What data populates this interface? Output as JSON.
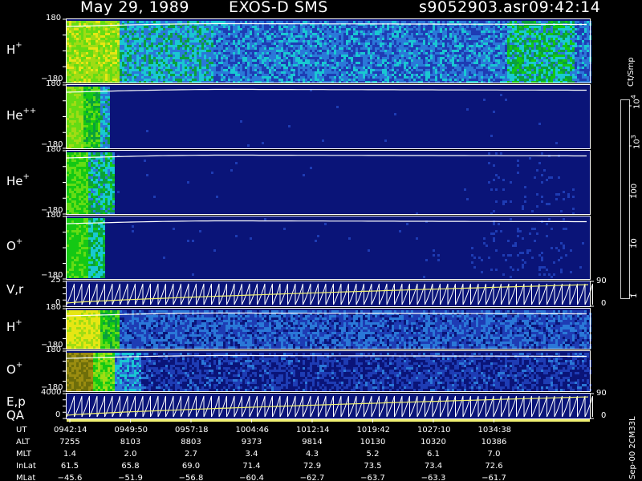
{
  "header": {
    "date": "May 29, 1989",
    "instrument": "EXOS-D SMS",
    "file": "s9052903.asr",
    "time": "09:42:14"
  },
  "colors": {
    "background": "#000000",
    "panel_fill": "#0a1478",
    "trace": "#ffffff",
    "position_line": "#f0f070"
  },
  "panels": [
    {
      "id": "h-plus-1",
      "species": "H",
      "charge": "+",
      "ymax": "180",
      "ymin": "−180"
    },
    {
      "id": "he-plus-plus",
      "species": "He",
      "charge": "++",
      "ymax": "180",
      "ymin": "−180"
    },
    {
      "id": "he-plus",
      "species": "He",
      "charge": "+",
      "ymax": "180",
      "ymin": "−180"
    },
    {
      "id": "o-plus-1",
      "species": "O",
      "charge": "+",
      "ymax": "180",
      "ymin": "−180"
    },
    {
      "id": "vr",
      "label": "V,r",
      "ymax": "25",
      "ymin": "0",
      "right_top": "90",
      "right_bottom": "0"
    },
    {
      "id": "h-plus-2",
      "species": "H",
      "charge": "+",
      "ymax": "180",
      "ymin": "−180"
    },
    {
      "id": "o-plus-2",
      "species": "O",
      "charge": "+",
      "ymax": "180",
      "ymin": "−180"
    },
    {
      "id": "ep",
      "label": "E,p",
      "label2": "QA",
      "ymax": "4000",
      "ymin": "0",
      "right_top": "90",
      "right_bottom": "0"
    }
  ],
  "colorbar": {
    "unit": "Ct/Smp",
    "ticks": [
      "1",
      "10",
      "100",
      "10",
      "10"
    ],
    "tick_exponents": [
      "",
      "",
      "",
      "3",
      "4"
    ],
    "colors": [
      "#0a1478",
      "#1e3cb4",
      "#2a78d8",
      "#19c8d2",
      "#0aa03c",
      "#14c814",
      "#64dc14",
      "#a0dc14",
      "#e6e614",
      "#9a8c10",
      "#6e6e0a",
      "#d21e0a",
      "#8c0a0a",
      "#ffffff"
    ]
  },
  "footer": {
    "rows": [
      {
        "name": "UT",
        "values": [
          "0942:14",
          "0949:50",
          "0957:18",
          "1004:46",
          "1012:14",
          "1019:42",
          "1027:10",
          "1034:38"
        ]
      },
      {
        "name": "ALT",
        "values": [
          "7255",
          "8103",
          "8803",
          "9373",
          "9814",
          "10130",
          "10320",
          "10386"
        ]
      },
      {
        "name": "MLT",
        "values": [
          "1.4",
          "2.0",
          "2.7",
          "3.4",
          "4.3",
          "5.2",
          "6.1",
          "7.0"
        ]
      },
      {
        "name": "InLat",
        "values": [
          "61.5",
          "65.8",
          "69.0",
          "71.4",
          "72.9",
          "73.5",
          "73.4",
          "72.6"
        ]
      },
      {
        "name": "MLat",
        "values": [
          "−45.6",
          "−51.9",
          "−56.8",
          "−60.4",
          "−62.7",
          "−63.7",
          "−63.3",
          "−61.7"
        ]
      }
    ],
    "side_text": "Sep-00  2CM33L"
  },
  "chart_data": {
    "type": "heatmap",
    "title": "May 29, 1989   EXOS-D SMS",
    "x_labels": [
      "0942:14",
      "0949:50",
      "0957:18",
      "1004:46",
      "1012:14",
      "1019:42",
      "1027:10",
      "1034:38"
    ],
    "pitch_angle_range": [
      -180,
      180
    ],
    "color_scale": "log",
    "color_range": [
      1,
      10000
    ],
    "vr_range": [
      0,
      25
    ],
    "ep_range": [
      0,
      4000
    ],
    "right_axis_range": [
      0,
      90
    ]
  }
}
